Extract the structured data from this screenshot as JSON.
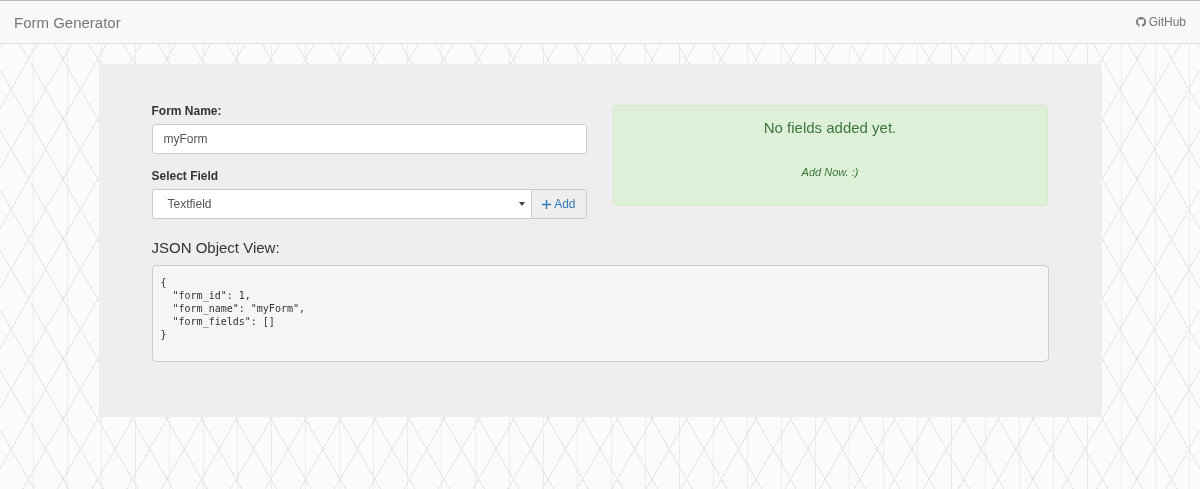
{
  "navbar": {
    "brand": "Form Generator",
    "github_link": "GitHub"
  },
  "form": {
    "name_label": "Form Name:",
    "name_value": "myForm",
    "select_label": "Select Field",
    "select_value": "Textfield",
    "add_button": "Add"
  },
  "notice": {
    "title": "No fields added yet.",
    "link": "Add Now. :)"
  },
  "json_view": {
    "title": "JSON Object View:",
    "lines": [
      "{",
      "  \"form_id\": 1,",
      "  \"form_name\": \"myForm\",",
      "  \"form_fields\": []",
      "}"
    ]
  }
}
